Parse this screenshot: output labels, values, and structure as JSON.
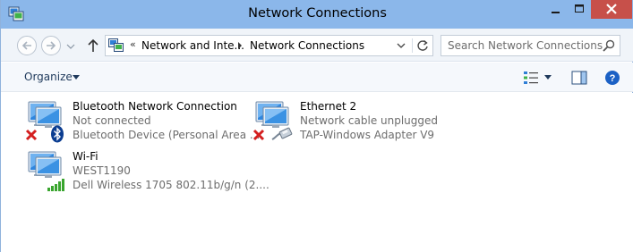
{
  "window": {
    "title": "Network Connections"
  },
  "navigation": {
    "address_overflow": "«",
    "address_segments": [
      "Network and Inte...",
      "Network Connections"
    ],
    "search_placeholder": "Search Network Connections"
  },
  "toolbar": {
    "organize_label": "Organize"
  },
  "connections": [
    {
      "name": "Bluetooth Network Connection",
      "status": "Not connected",
      "device": "Bluetooth Device (Personal Area ...",
      "icon": "network-computer-icon",
      "badge": "bluetooth-icon",
      "overlay": "red-x-disconnected-icon"
    },
    {
      "name": "Ethernet 2",
      "status": "Network cable unplugged",
      "device": "TAP-Windows Adapter V9",
      "icon": "network-computer-icon",
      "badge": "ethernet-cable-icon",
      "overlay": "red-x-disconnected-icon"
    },
    {
      "name": "Wi-Fi",
      "status": "WEST1190",
      "device": "Dell Wireless 1705 802.11b/g/n (2....",
      "icon": "network-computer-icon",
      "badge": "wifi-signal-bars-icon",
      "overlay": ""
    }
  ],
  "colors": {
    "title_bar": "#8bb7ea",
    "close_button": "#c7504a",
    "link_text": "#1e395b",
    "secondary_text": "#6d6d6d",
    "signal_green": "#3aa52f",
    "error_red": "#d41f1f"
  }
}
